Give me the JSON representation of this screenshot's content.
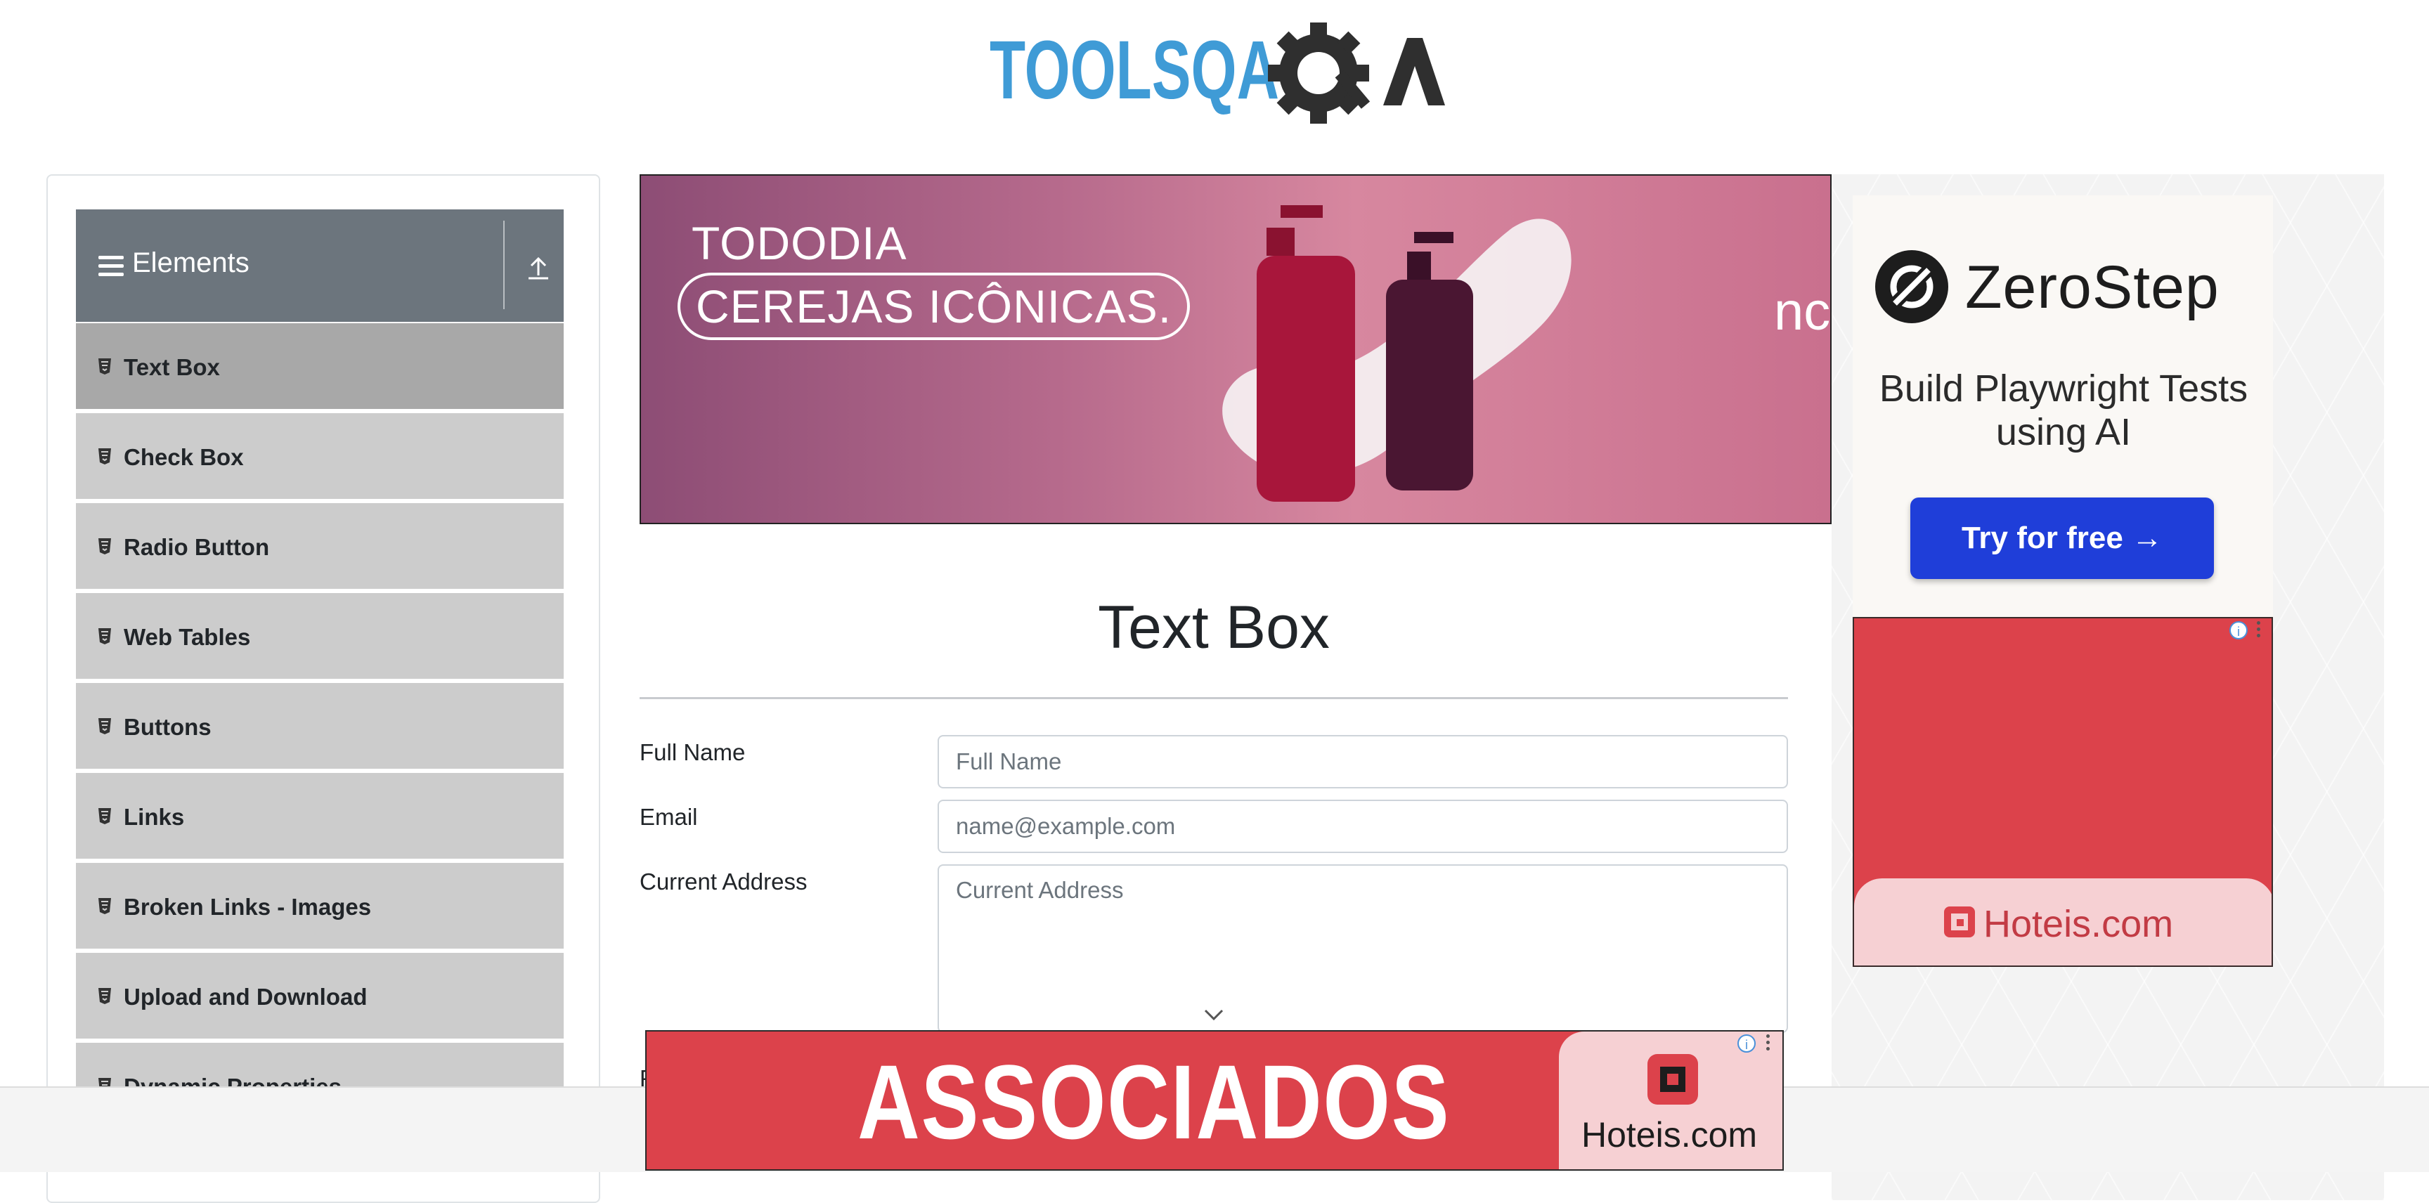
{
  "header": {
    "logo_text": "TOOLSQA"
  },
  "sidebar": {
    "group_title": "Elements",
    "items": [
      {
        "label": "Text Box",
        "active": true
      },
      {
        "label": "Check Box"
      },
      {
        "label": "Radio Button"
      },
      {
        "label": "Web Tables"
      },
      {
        "label": "Buttons"
      },
      {
        "label": "Links"
      },
      {
        "label": "Broken Links - Images"
      },
      {
        "label": "Upload and Download"
      },
      {
        "label": "Dynamic Properties"
      }
    ]
  },
  "banner": {
    "line1": "TODODIA",
    "line2": "CEREJAS ICÔNICAS.",
    "brand_fragment": "nc"
  },
  "main": {
    "title": "Text Box",
    "form": {
      "full_name": {
        "label": "Full Name",
        "placeholder": "Full Name"
      },
      "email": {
        "label": "Email",
        "placeholder": "name@example.com"
      },
      "current_address": {
        "label": "Current Address",
        "placeholder": "Current Address"
      },
      "partial_label": "P"
    }
  },
  "ads": {
    "zerostep": {
      "brand": "ZeroStep",
      "headline": "Build Playwright Tests using AI",
      "cta": "Try for free →"
    },
    "hoteis_right": {
      "brand": "Hoteis.com"
    },
    "bottom": {
      "headline": "ASSOCIADOS",
      "brand": "Hoteis.com"
    },
    "brand_color": "#dc424b"
  },
  "colors": {
    "sidebar_header": "#6c757d",
    "menu_item": "#cccccc",
    "menu_item_active": "#a8a8a8",
    "logo_blue": "#3f9bd6",
    "logo_dark": "#2f2f2f",
    "cta_blue": "#1f3ed9"
  }
}
